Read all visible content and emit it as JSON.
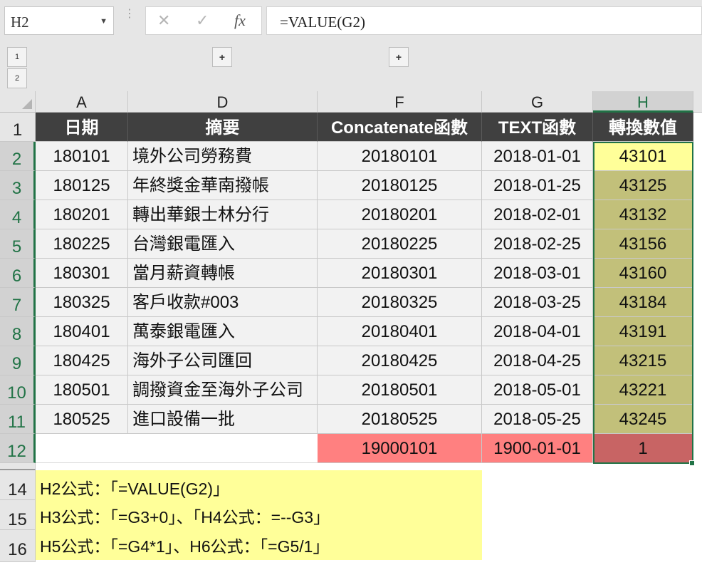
{
  "formula_bar": {
    "name_box": "H2",
    "formula": "=VALUE(G2)",
    "cancel_icon": "✕",
    "enter_icon": "✓",
    "fx_icon": "fx"
  },
  "outline": {
    "level1": "1",
    "level2": "2",
    "expand1": "+",
    "expand2": "+"
  },
  "columns": [
    "A",
    "D",
    "F",
    "G",
    "H"
  ],
  "rows": [
    "1",
    "2",
    "3",
    "4",
    "5",
    "6",
    "7",
    "8",
    "9",
    "10",
    "11",
    "12",
    "14",
    "15",
    "16"
  ],
  "headers": [
    "日期",
    "摘要",
    "Concatenate函數",
    "TEXT函數",
    "轉換數值"
  ],
  "data": [
    [
      "180101",
      "境外公司勞務費",
      "20180101",
      "2018-01-01",
      "43101"
    ],
    [
      "180125",
      "年終獎金華南撥帳",
      "20180125",
      "2018-01-25",
      "43125"
    ],
    [
      "180201",
      "轉出華銀士林分行",
      "20180201",
      "2018-02-01",
      "43132"
    ],
    [
      "180225",
      "台灣銀電匯入",
      "20180225",
      "2018-02-25",
      "43156"
    ],
    [
      "180301",
      "當月薪資轉帳",
      "20180301",
      "2018-03-01",
      "43160"
    ],
    [
      "180325",
      "客戶收款#003",
      "20180325",
      "2018-03-25",
      "43184"
    ],
    [
      "180401",
      "萬泰銀電匯入",
      "20180401",
      "2018-04-01",
      "43191"
    ],
    [
      "180425",
      "海外子公司匯回",
      "20180425",
      "2018-04-25",
      "43215"
    ],
    [
      "180501",
      "調撥資金至海外子公司",
      "20180501",
      "2018-05-01",
      "43221"
    ],
    [
      "180525",
      "進口設備一批",
      "20180525",
      "2018-05-25",
      "43245"
    ]
  ],
  "row12": [
    "19000101",
    "1900-01-01",
    "1"
  ],
  "notes": [
    "H2公式：「=VALUE(G2)」",
    "H3公式：「=G3+0」、「H4公式：=--G3」",
    "H5公式：「=G4*1」、H6公式：「=G5/1」"
  ],
  "colors": {
    "header_bg": "#404040",
    "highlight": "#c2c07a",
    "active_cell": "#ffff99",
    "pink": "#ff8080",
    "red": "#c86464",
    "note_bg": "#ffff99",
    "selection": "#217346"
  }
}
